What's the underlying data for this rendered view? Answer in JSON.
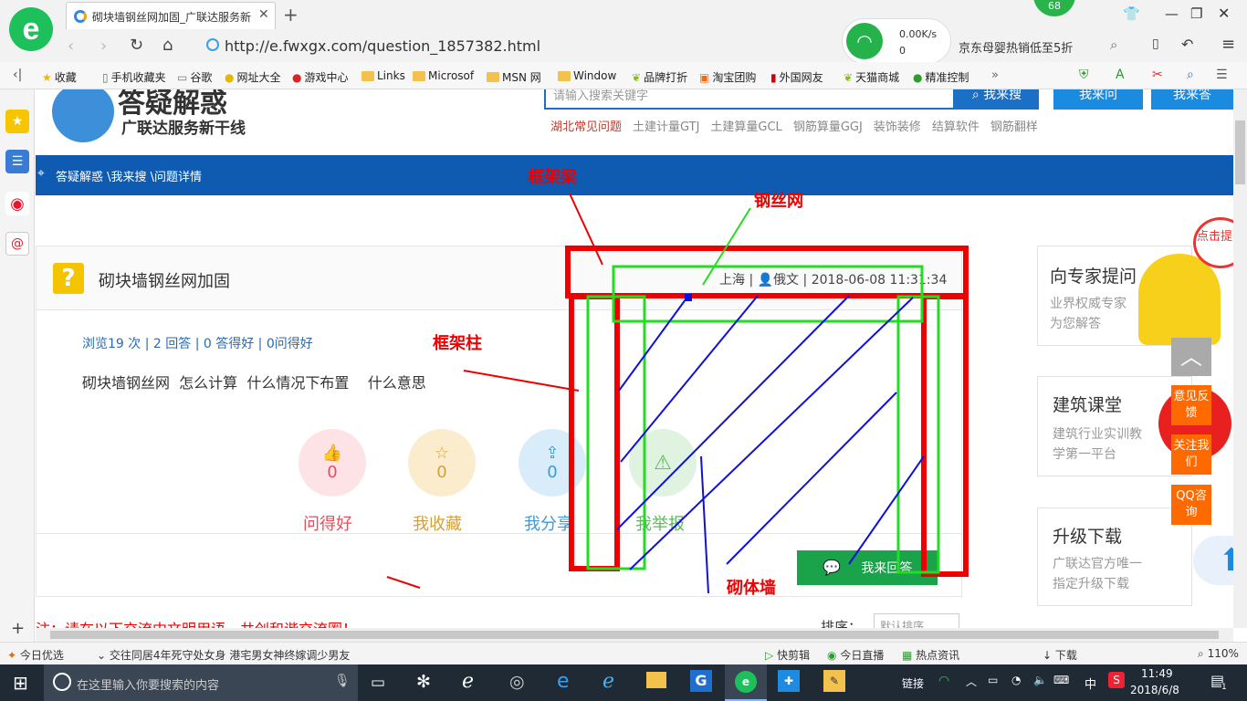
{
  "browser": {
    "tab_title": "砌块墙钢丝网加固_广联达服务新",
    "url": "http://e.fwxgx.com/question_1857382.html",
    "net_speed": "0.00K/s",
    "net_count": "0",
    "badge": "68",
    "ad_text": "京东母婴热销低至5折",
    "favorites": [
      "收藏",
      "手机收藏夹",
      "谷歌",
      "网址大全",
      "游戏中心",
      "Links",
      "Microsof",
      "MSN 网",
      "Window",
      "品牌打折",
      "淘宝团购",
      "外国网友",
      "天猫商城",
      "精准控制"
    ],
    "more": "»"
  },
  "site": {
    "logo_title": "答疑解惑",
    "logo_subtitle": "广联达服务新干线",
    "search_placeholder": "请输入搜索关键字",
    "search_button": "我来搜",
    "ask_button": "我来问",
    "answer_button": "我来答",
    "hot_links": [
      "湖北常见问题",
      "土建计量GTJ",
      "土建算量GCL",
      "钢筋算量GGJ",
      "装饰装修",
      "结算软件",
      "钢筋翻样"
    ],
    "breadcrumb": "答疑解惑 \\我来搜 \\问题详情"
  },
  "question": {
    "title": "砌块墙钢丝网加固",
    "location": "上海",
    "user": "俄文",
    "datetime": "2018-06-08 11:31:34",
    "meta": "浏览19 次 | 2 回答 | 0 答得好 | 0问得好",
    "body": "砌块墙钢丝网  怎么计算  什么情况下布置    什么意思",
    "stats": [
      {
        "label": "问得好",
        "count": "0",
        "color": "#e2505e"
      },
      {
        "label": "我收藏",
        "count": "0",
        "color": "#d4a03c"
      },
      {
        "label": "我分享",
        "count": "0",
        "color": "#3e9ad6"
      },
      {
        "label": "我举报",
        "count": "",
        "color": "#5cb85c"
      }
    ],
    "answer_button": "我来回答",
    "notice": "注：请在以下交流中文明用语，共创和谐交流圈！",
    "sort_label": "排序：",
    "sort_value": "默认排序"
  },
  "annotations": {
    "beam": "框架梁",
    "mesh": "钢丝网",
    "column": "框架柱",
    "wall": "砌体墙"
  },
  "sidebar_cards": [
    {
      "title": "向专家提问",
      "desc1": "业界权威专家",
      "desc2": "为您解答"
    },
    {
      "title": "建筑课堂",
      "desc1": "建筑行业实训教",
      "desc2": "学第一平台"
    },
    {
      "title": "升级下载",
      "desc1": "广联达官方唯一",
      "desc2": "指定升级下载"
    }
  ],
  "float_buttons": [
    "意见反馈",
    "关注我们",
    "QQ咨询"
  ],
  "corner_tag": "点击提问",
  "status": {
    "today": "今日优选",
    "news": "交往同居4年死守处女身 港宅男女神终嫁调少男友",
    "items": [
      "快剪辑",
      "今日直播",
      "热点资讯",
      "下载"
    ],
    "zoom": "110%"
  },
  "taskbar": {
    "search_placeholder": "在这里输入你要搜索的内容",
    "tray_link": "链接",
    "ime": "中",
    "time": "11:49",
    "date": "2018/6/8",
    "notif": "1"
  }
}
